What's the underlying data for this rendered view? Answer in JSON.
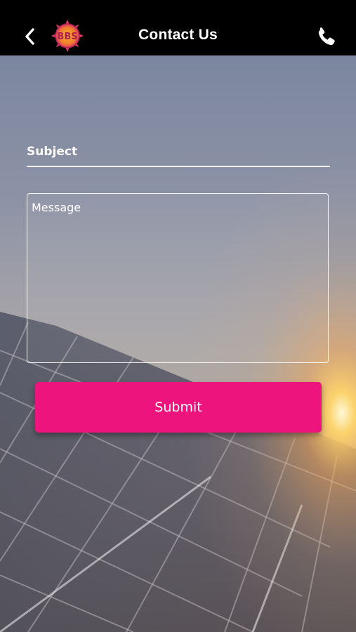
{
  "header": {
    "title": "Contact Us",
    "back_icon": "chevron-left-icon",
    "logo_text": "BBS",
    "phone_icon": "phone-icon",
    "background_color": "#000000"
  },
  "form": {
    "subject_placeholder": "Subject",
    "subject_value": "",
    "message_placeholder": "Message",
    "message_value": "",
    "submit_label": "Submit"
  },
  "colors": {
    "submit_button": "#ee147e",
    "text": "#ffffff"
  },
  "background": {
    "description_icon": "solar-panels-sunset-image"
  }
}
